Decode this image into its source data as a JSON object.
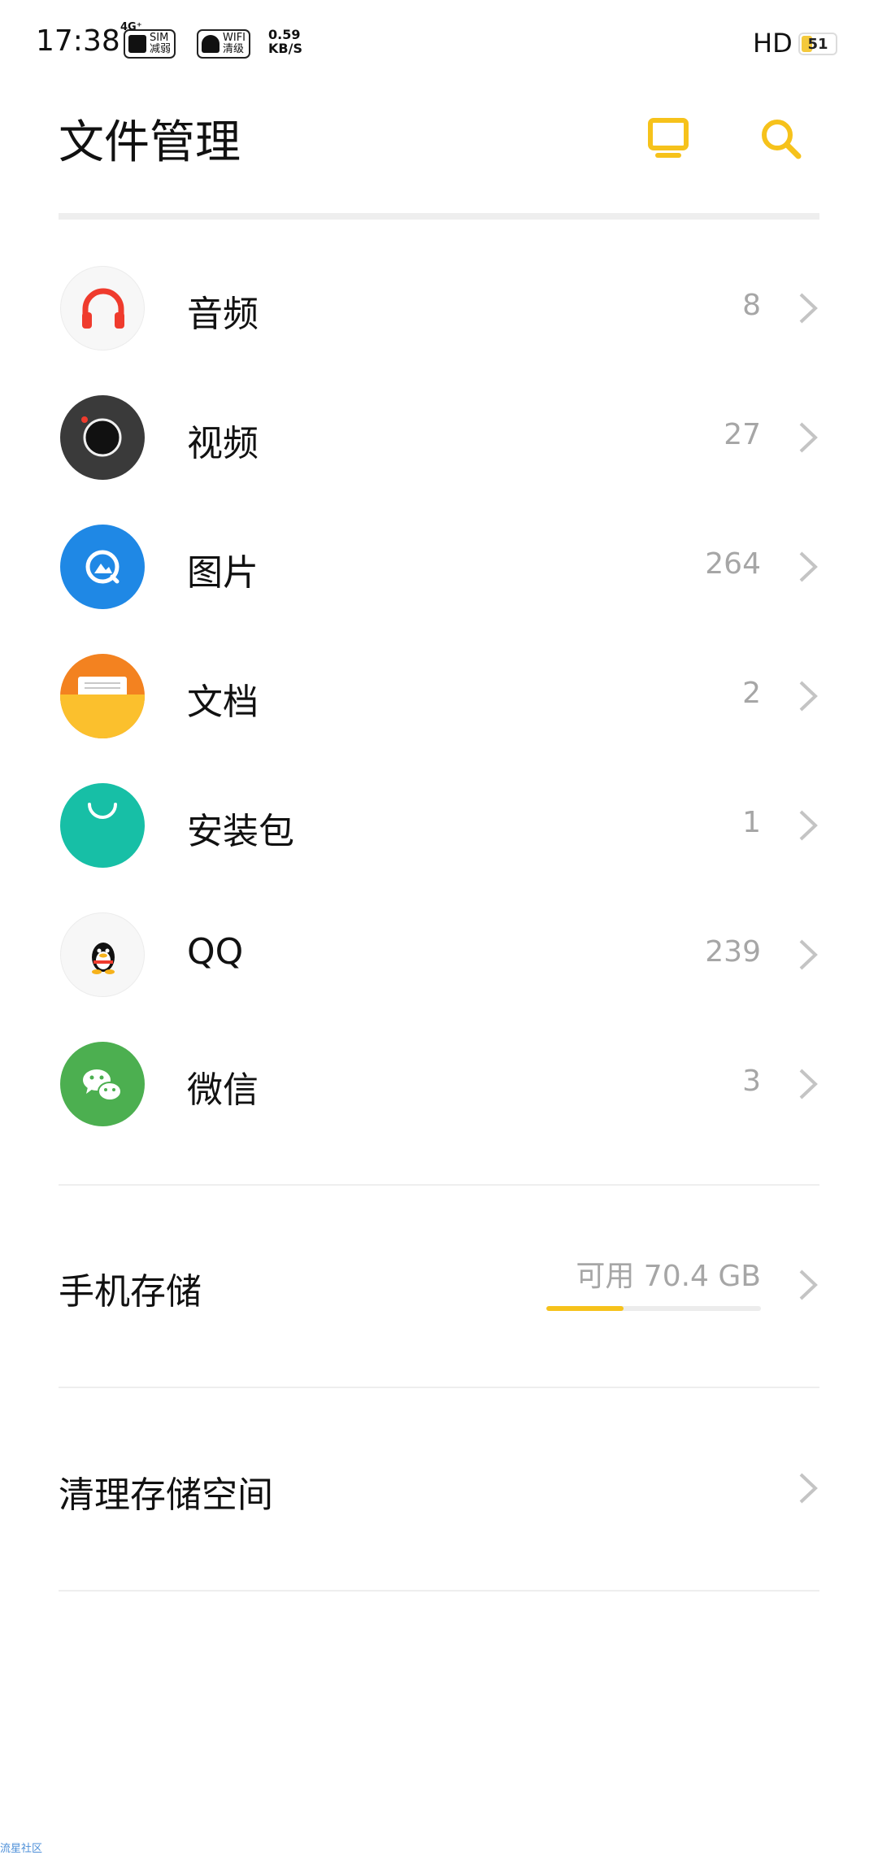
{
  "status_bar": {
    "time": "17:38",
    "network_type": "4G⁺",
    "sim_line1": "SIM",
    "sim_line2": "减弱",
    "wifi_line1": "WIFI",
    "wifi_line2": "清级",
    "speed_value": "0.59",
    "speed_unit": "KB/S",
    "hd_label": "HD",
    "battery_level": "51",
    "battery_fraction": 0.3
  },
  "header": {
    "title": "文件管理"
  },
  "categories": [
    {
      "label": "音频",
      "count": "8"
    },
    {
      "label": "视频",
      "count": "27"
    },
    {
      "label": "图片",
      "count": "264"
    },
    {
      "label": "文档",
      "count": "2"
    },
    {
      "label": "安装包",
      "count": "1"
    },
    {
      "label": "QQ",
      "count": "239"
    },
    {
      "label": "微信",
      "count": "3"
    }
  ],
  "storage": {
    "title": "手机存储",
    "available_text": "可用 70.4 GB",
    "used_fraction": 0.36
  },
  "cleanup": {
    "title": "清理存储空间"
  },
  "colors": {
    "accent": "#f6c21b",
    "audio": "#ef3b2d",
    "video": "#3a3a3a",
    "image": "#1f88e5",
    "document_top": "#f38220",
    "document_bottom": "#fbc02d",
    "apk": "#17bfa6",
    "wechat": "#4caf50"
  },
  "watermark": "流星社区"
}
